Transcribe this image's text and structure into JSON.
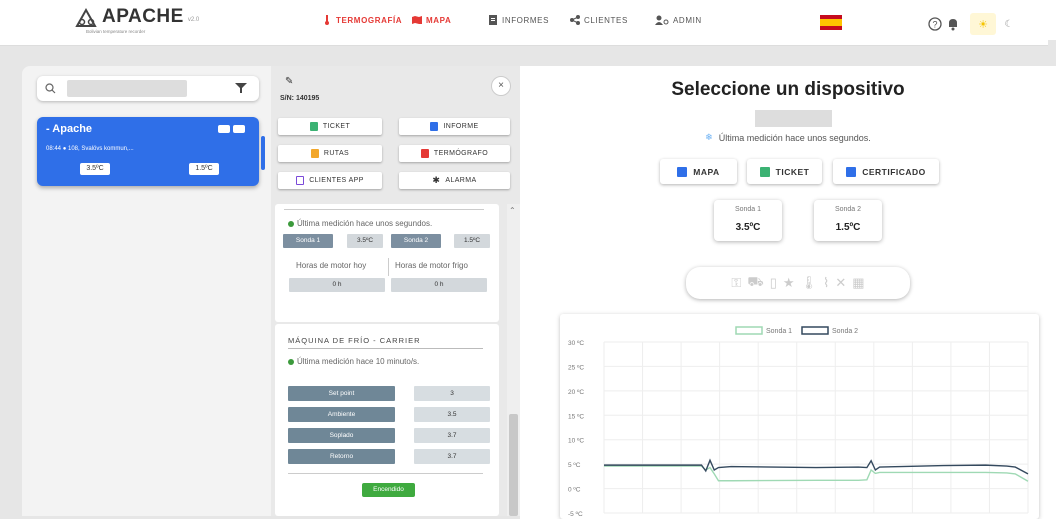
{
  "header": {
    "logo_text": "APACHE",
    "logo_version": "v2.0",
    "logo_subtitle": "Bolivian temperature recorder",
    "nav": [
      {
        "label": "TERMOGRAFÍA",
        "icon": "thermometer-icon",
        "active": true
      },
      {
        "label": "MAPA",
        "icon": "map-icon",
        "active": true
      },
      {
        "label": "INFORMES",
        "icon": "document-icon",
        "active": false
      },
      {
        "label": "CLIENTES",
        "icon": "share-icon",
        "active": false
      },
      {
        "label": "ADMIN",
        "icon": "admin-icon",
        "active": false
      }
    ],
    "flag": "spain-flag",
    "accent_color": "#e53935"
  },
  "left": {
    "device": {
      "name": "- Apache",
      "time": "08:44",
      "location": "108, Svalövs kommun,...",
      "temp1": "3.5ºC",
      "temp2": "1.5ºC"
    },
    "card_color": "#2f6fe8"
  },
  "middle": {
    "sn": "S/N: 140195",
    "close": "×",
    "actions": [
      {
        "label": "TICKET",
        "color": "#3bb273"
      },
      {
        "label": "INFORME",
        "color": "#2f6fe8"
      },
      {
        "label": "RUTAS",
        "color": "#f2a72b"
      },
      {
        "label": "TERMÓGRAFO",
        "color": "#e53935"
      },
      {
        "label": "CLIENTES APP",
        "color": "#7b4ad9"
      },
      {
        "label": "ALARMA",
        "color": "#333333"
      }
    ],
    "box1": {
      "last": "Última medición hace unos segundos.",
      "sonda1_label": "Sonda 1",
      "sonda1_value": "3.5ºC",
      "sonda2_label": "Sonda 2",
      "sonda2_value": "1.5ºC",
      "hours_motor": "Horas de motor hoy",
      "hours_frigo": "Horas de motor frigo",
      "hours_motor_value": "0 h",
      "hours_frigo_value": "0 h"
    },
    "box2": {
      "title": "MÁQUINA DE FRÍO - CARRIER",
      "last": "Última medición hace 10 minuto/s.",
      "rows": [
        {
          "label": "Set point",
          "value": "3"
        },
        {
          "label": "Ambiente",
          "value": "3.5"
        },
        {
          "label": "Soplado",
          "value": "3.7"
        },
        {
          "label": "Retorno",
          "value": "3.7"
        }
      ],
      "status": "Encendido"
    }
  },
  "right": {
    "title": "Seleccione un dispositivo",
    "last": "Última medición hace unos segundos.",
    "buttons": [
      {
        "label": "MAPA",
        "color": "#2f6fe8"
      },
      {
        "label": "TICKET",
        "color": "#3bb273"
      },
      {
        "label": "CERTIFICADO",
        "color": "#2f6fe8"
      }
    ],
    "sonda1": {
      "name": "Sonda 1",
      "value": "3.5ºC"
    },
    "sonda2": {
      "name": "Sonda 2",
      "value": "1.5ºC"
    }
  },
  "chart_data": {
    "type": "line",
    "title": "",
    "xlabel": "",
    "ylabel": "",
    "yticks": [
      "30 ºC",
      "25 ºC",
      "20 ºC",
      "15 ºC",
      "10 ºC",
      "5 ºC",
      "0 ºC",
      "-5 ºC"
    ],
    "ylim": [
      -5,
      30
    ],
    "grid": true,
    "legend_position": "top",
    "x": [
      0,
      0.23,
      0.24,
      0.25,
      0.26,
      0.27,
      0.3,
      0.5,
      0.6,
      0.62,
      0.63,
      0.64,
      0.65,
      0.7,
      0.8,
      0.9,
      0.95,
      0.97,
      1.0
    ],
    "series": [
      {
        "name": "Sonda 1",
        "color": "#9fd9b4",
        "values": [
          4.6,
          4.6,
          3.8,
          4.3,
          3.0,
          1.6,
          1.6,
          1.7,
          1.7,
          1.8,
          3.8,
          3.1,
          3.3,
          3.3,
          3.3,
          3.3,
          3.2,
          3.0,
          1.5
        ]
      },
      {
        "name": "Sonda 2",
        "color": "#34495e",
        "values": [
          4.8,
          4.8,
          3.6,
          5.8,
          3.8,
          4.3,
          4.5,
          4.3,
          4.4,
          4.3,
          5.7,
          3.8,
          4.4,
          4.5,
          4.7,
          4.8,
          4.6,
          4.4,
          3.0
        ]
      }
    ]
  }
}
